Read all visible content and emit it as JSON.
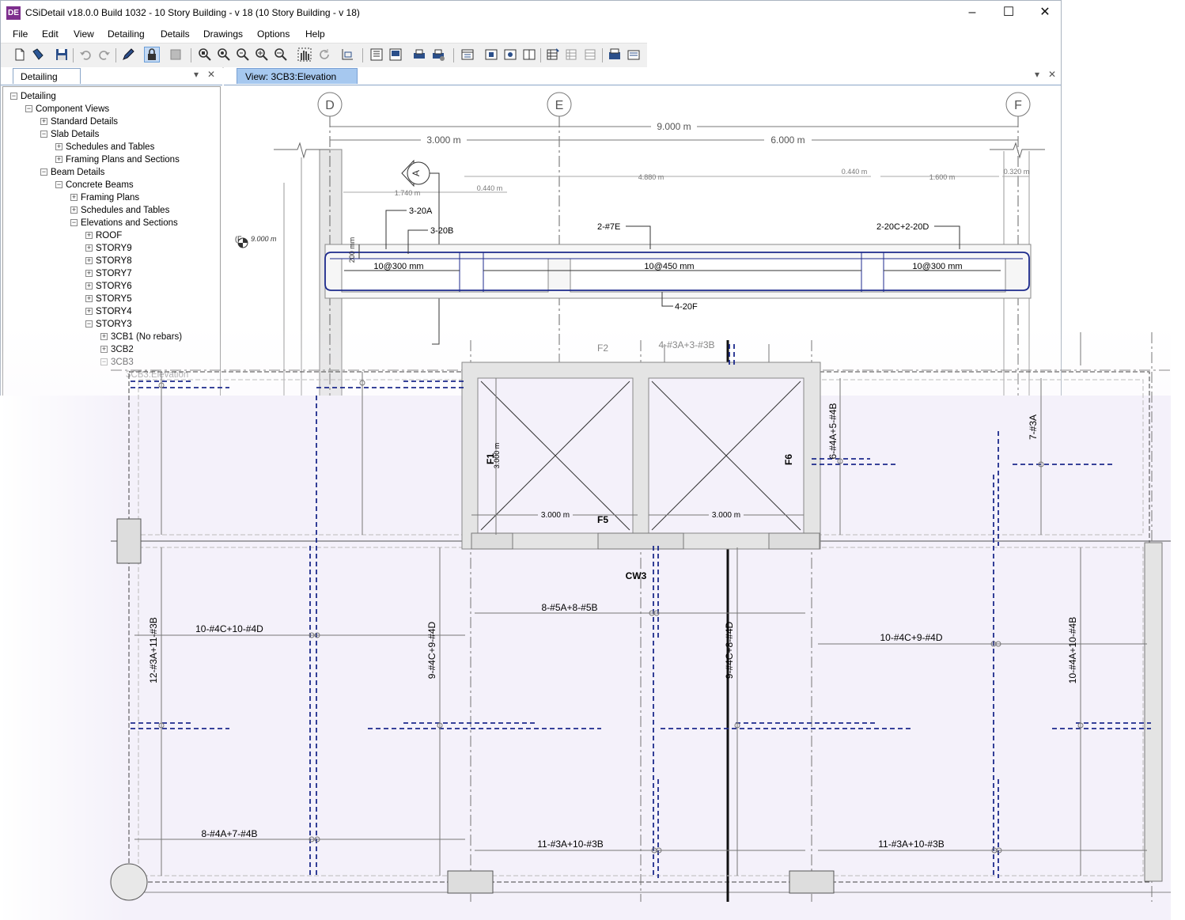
{
  "app": {
    "logo": "DE",
    "title": "CSiDetail v18.0.0 Build 1032 - 10 Story Building - v 18 (10 Story Building - v 18)"
  },
  "window_controls": [
    "minimize-icon",
    "maximize-icon",
    "close-icon"
  ],
  "menu": [
    "File",
    "Edit",
    "View",
    "Detailing",
    "Details",
    "Drawings",
    "Options",
    "Help"
  ],
  "toolbar_icons": [
    "new-file-icon",
    "open-file-icon",
    "save-icon",
    "undo-icon",
    "redo-icon",
    "pencil-icon",
    "lock-icon",
    "display-icon",
    "zoom-window-icon",
    "zoom-extents-icon",
    "zoom-previous-icon",
    "zoom-in-icon",
    "zoom-out-icon",
    "pan-icon",
    "refresh-icon",
    "set-limits-icon",
    "new-sheet-icon",
    "sheet-icon",
    "print-preview-icon",
    "print-setup-icon",
    "view-options-icon",
    "section-icon",
    "section-icon-2",
    "detail-icon",
    "table-icon",
    "table-icon-2",
    "table-icon-3",
    "export-icon",
    "export-dxf-icon"
  ],
  "left_panel": {
    "tab": "Detailing",
    "tree": [
      {
        "label": "Detailing",
        "level": 0,
        "expanded": true
      },
      {
        "label": "Component Views",
        "level": 1,
        "expanded": true
      },
      {
        "label": "Standard Details",
        "level": 2,
        "expanded": false
      },
      {
        "label": "Slab Details",
        "level": 2,
        "expanded": true
      },
      {
        "label": "Schedules and Tables",
        "level": 3,
        "expanded": false
      },
      {
        "label": "Framing Plans and Sections",
        "level": 3,
        "expanded": false
      },
      {
        "label": "Beam Details",
        "level": 2,
        "expanded": true
      },
      {
        "label": "Concrete Beams",
        "level": 3,
        "expanded": true
      },
      {
        "label": "Framing Plans",
        "level": 4,
        "expanded": false
      },
      {
        "label": "Schedules and Tables",
        "level": 4,
        "expanded": false
      },
      {
        "label": "Elevations and Sections",
        "level": 4,
        "expanded": true
      },
      {
        "label": "ROOF",
        "level": 5,
        "expanded": false
      },
      {
        "label": "STORY9",
        "level": 5,
        "expanded": false
      },
      {
        "label": "STORY8",
        "level": 5,
        "expanded": false
      },
      {
        "label": "STORY7",
        "level": 5,
        "expanded": false
      },
      {
        "label": "STORY6",
        "level": 5,
        "expanded": false
      },
      {
        "label": "STORY5",
        "level": 5,
        "expanded": false
      },
      {
        "label": "STORY4",
        "level": 5,
        "expanded": false
      },
      {
        "label": "STORY3",
        "level": 5,
        "expanded": true
      },
      {
        "label": "3CB1 (No rebars)",
        "level": 6,
        "expanded": false
      },
      {
        "label": "3CB2",
        "level": 6,
        "expanded": false
      },
      {
        "label": "3CB3",
        "level": 6,
        "expanded": true
      },
      {
        "label": "3CB3:Elevation",
        "level": 7,
        "leaf": true
      }
    ]
  },
  "doc_tab": "View: 3CB3:Elevation",
  "elevation": {
    "grid_labels": [
      "D",
      "E",
      "F"
    ],
    "overall_dim": "9.000 m",
    "span_dims": [
      "3.000 m",
      "6.000 m"
    ],
    "small_dims": [
      "1.740 m",
      "0.440 m",
      "4.880 m",
      "0.440 m",
      "1.600 m",
      "0.320 m"
    ],
    "section_marker": "A",
    "level_label": "9.000 m",
    "level_prefix": "(F",
    "depth_label": "200 mm",
    "rebar_labels": [
      "3-20A",
      "3-20B",
      "2-#7E",
      "2-20C+2-20D",
      "4-20F"
    ],
    "stirrups": [
      "10@300 mm",
      "10@450 mm",
      "10@300 mm"
    ]
  },
  "plan": {
    "footing_labels": [
      "F2",
      "F1",
      "F5",
      "F6"
    ],
    "top_rebar": "4-#3A+3-#3B",
    "core_dims": [
      "3.000 m",
      "3.000 m",
      "3.000 m"
    ],
    "wall_label": "CW3",
    "rebar_labels_h": [
      "8-#5A+8-#5B",
      "10-#4C+10-#4D",
      "10-#4C+9-#4D",
      "8-#4A+7-#4B",
      "11-#3A+10-#3B",
      "11-#3A+10-#3B"
    ],
    "rebar_labels_v": [
      "12-#3A+11-#3B",
      "9-#4C+9-#4D",
      "9-#4C+8-#4D",
      "10-#4A+10-#4B",
      "7-#3A",
      "6-#4A+5-#4B"
    ]
  }
}
